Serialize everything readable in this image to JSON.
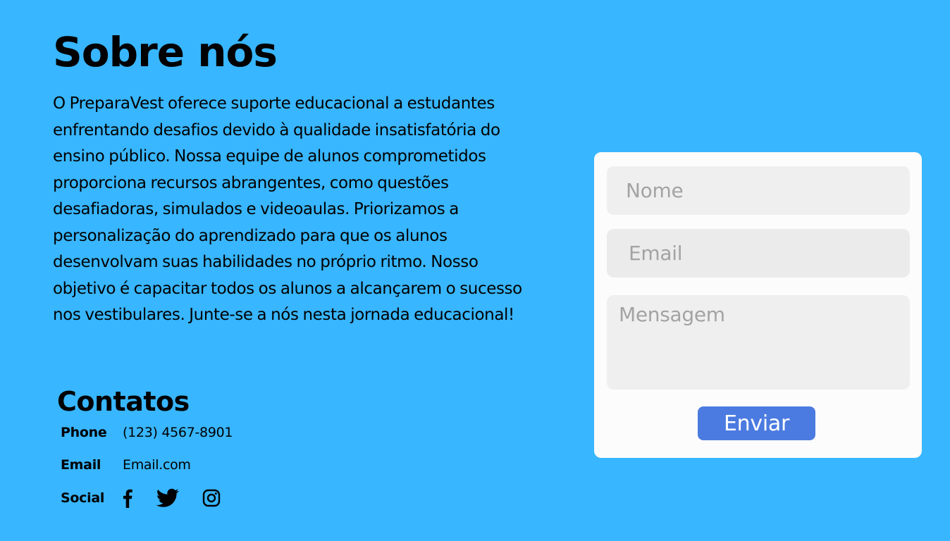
{
  "about": {
    "title": "Sobre nós",
    "text": "O PreparaVest oferece suporte educacional a estudantes enfrentando desafios devido à qualidade insatisfatória do ensino público. Nossa equipe de alunos comprometidos proporciona recursos abrangentes, como questões desafiadoras, simulados e videoaulas. Priorizamos a personalização do aprendizado para que os alunos desenvolvam suas habilidades no próprio ritmo. Nosso objetivo é capacitar todos os alunos a alcançarem o sucesso nos vestibulares. Junte-se a nós nesta jornada educacional!"
  },
  "contacts": {
    "title": "Contatos",
    "phone_label": "Phone",
    "phone_value": "(123) 4567-8901",
    "email_label": "Email",
    "email_value": "Email.com",
    "social_label": "Social",
    "social_icons": [
      "facebook-icon",
      "twitter-icon",
      "instagram-icon"
    ]
  },
  "form": {
    "name_placeholder": "Nome",
    "email_placeholder": "Email",
    "message_placeholder": "Mensagem",
    "name_value": "",
    "email_value": "",
    "message_value": "",
    "submit_label": "Enviar"
  },
  "colors": {
    "background": "#38b6ff",
    "card": "#fcfcfc",
    "field": "#efefef",
    "button": "#4b7be0",
    "placeholder": "#a3a3a3"
  }
}
